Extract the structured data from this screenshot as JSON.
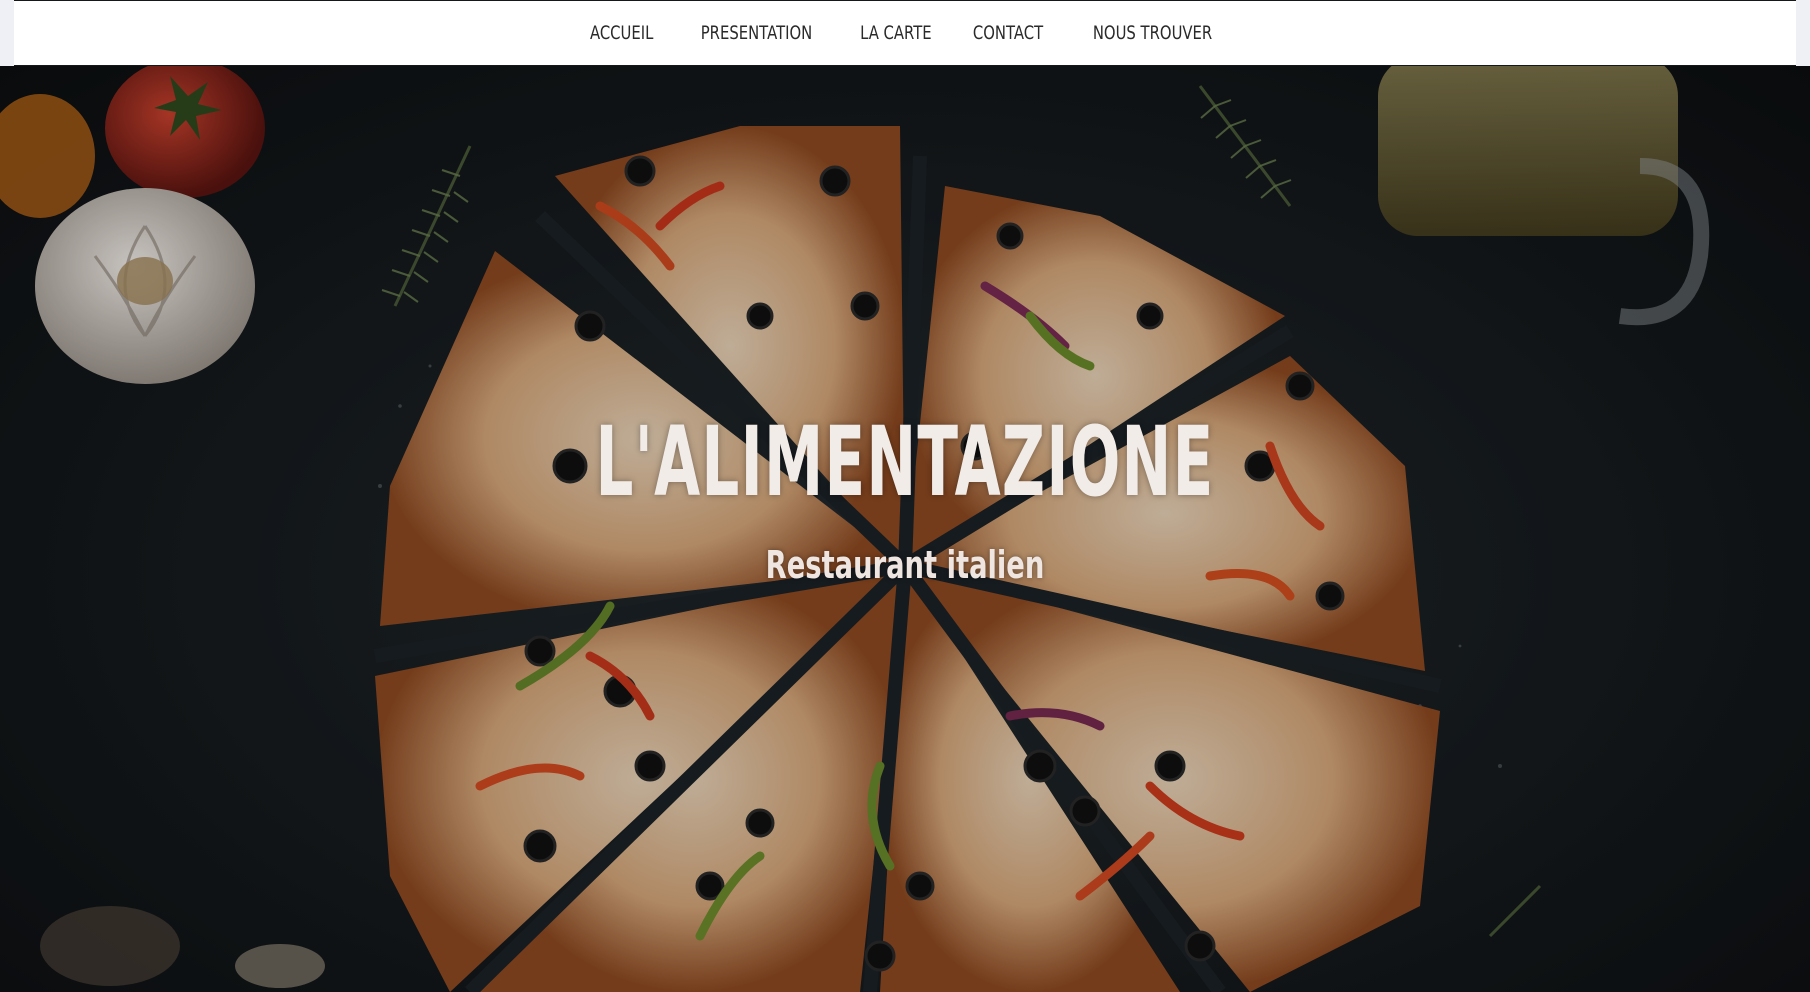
{
  "nav": {
    "items": [
      {
        "label": "ACCUEIL"
      },
      {
        "label": "PRESENTATION"
      },
      {
        "label": "LA CARTE"
      },
      {
        "label": "CONTACT"
      },
      {
        "label": "NOUS TROUVER"
      }
    ]
  },
  "hero": {
    "title": "L'ALIMENTAZIONE",
    "subtitle": "Restaurant italien",
    "background": "pizza-photo"
  },
  "colors": {
    "nav_bg": "#ffffff",
    "nav_text": "#2a2a2a",
    "hero_bg": "#161b1e",
    "hero_text": "#f2ece9"
  }
}
